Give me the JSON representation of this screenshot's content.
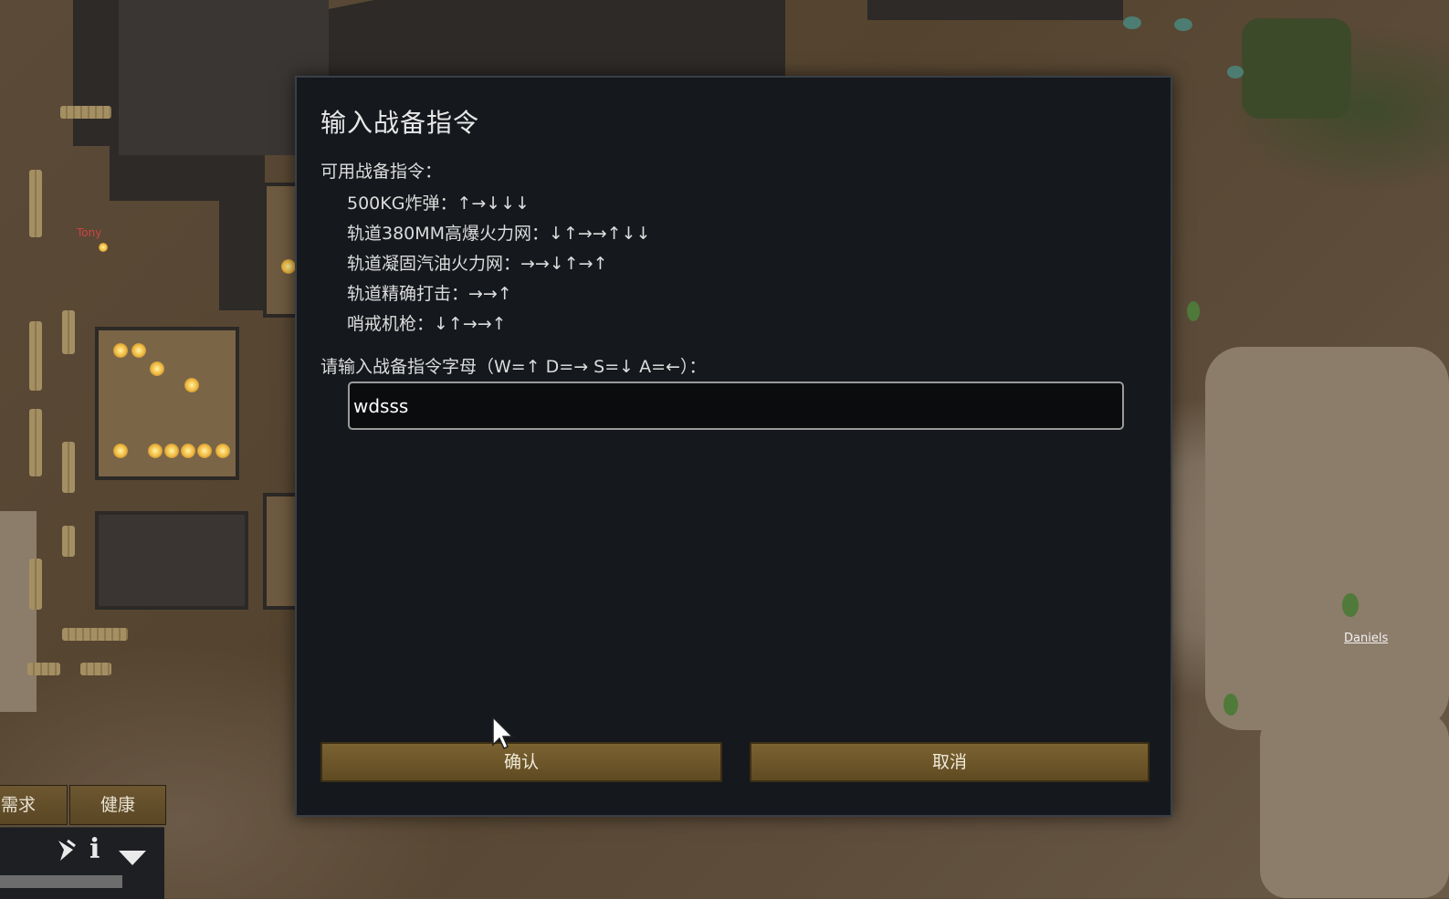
{
  "dialog": {
    "title": "输入战备指令",
    "commands_header": "可用战备指令：",
    "commands": [
      {
        "text": "500KG炸弹：↑→↓↓↓"
      },
      {
        "text": "轨道380MM高爆火力网：↓↑→→↑↓↓"
      },
      {
        "text": "轨道凝固汽油火力网：→→↓↑→↑"
      },
      {
        "text": "轨道精确打击：→→↑"
      },
      {
        "text": "哨戒机枪：↓↑→→↑"
      }
    ],
    "input_label": "请输入战备指令字母（W=↑ D=→ S=↓ A=←）：",
    "input_value": "wdsss",
    "confirm_label": "确认",
    "cancel_label": "取消"
  },
  "game_ui": {
    "tab_needs": "需求",
    "tab_health": "健康",
    "pawn_name_right": "Daniels",
    "pawn_name_left": "Tony",
    "bar_icons": [
      "flee-icon",
      "info-icon",
      "dropdown-icon"
    ]
  },
  "colors": {
    "dialog_bg": "#15181d",
    "button_brown": "#6b5428",
    "text": "#dcdcdc"
  }
}
